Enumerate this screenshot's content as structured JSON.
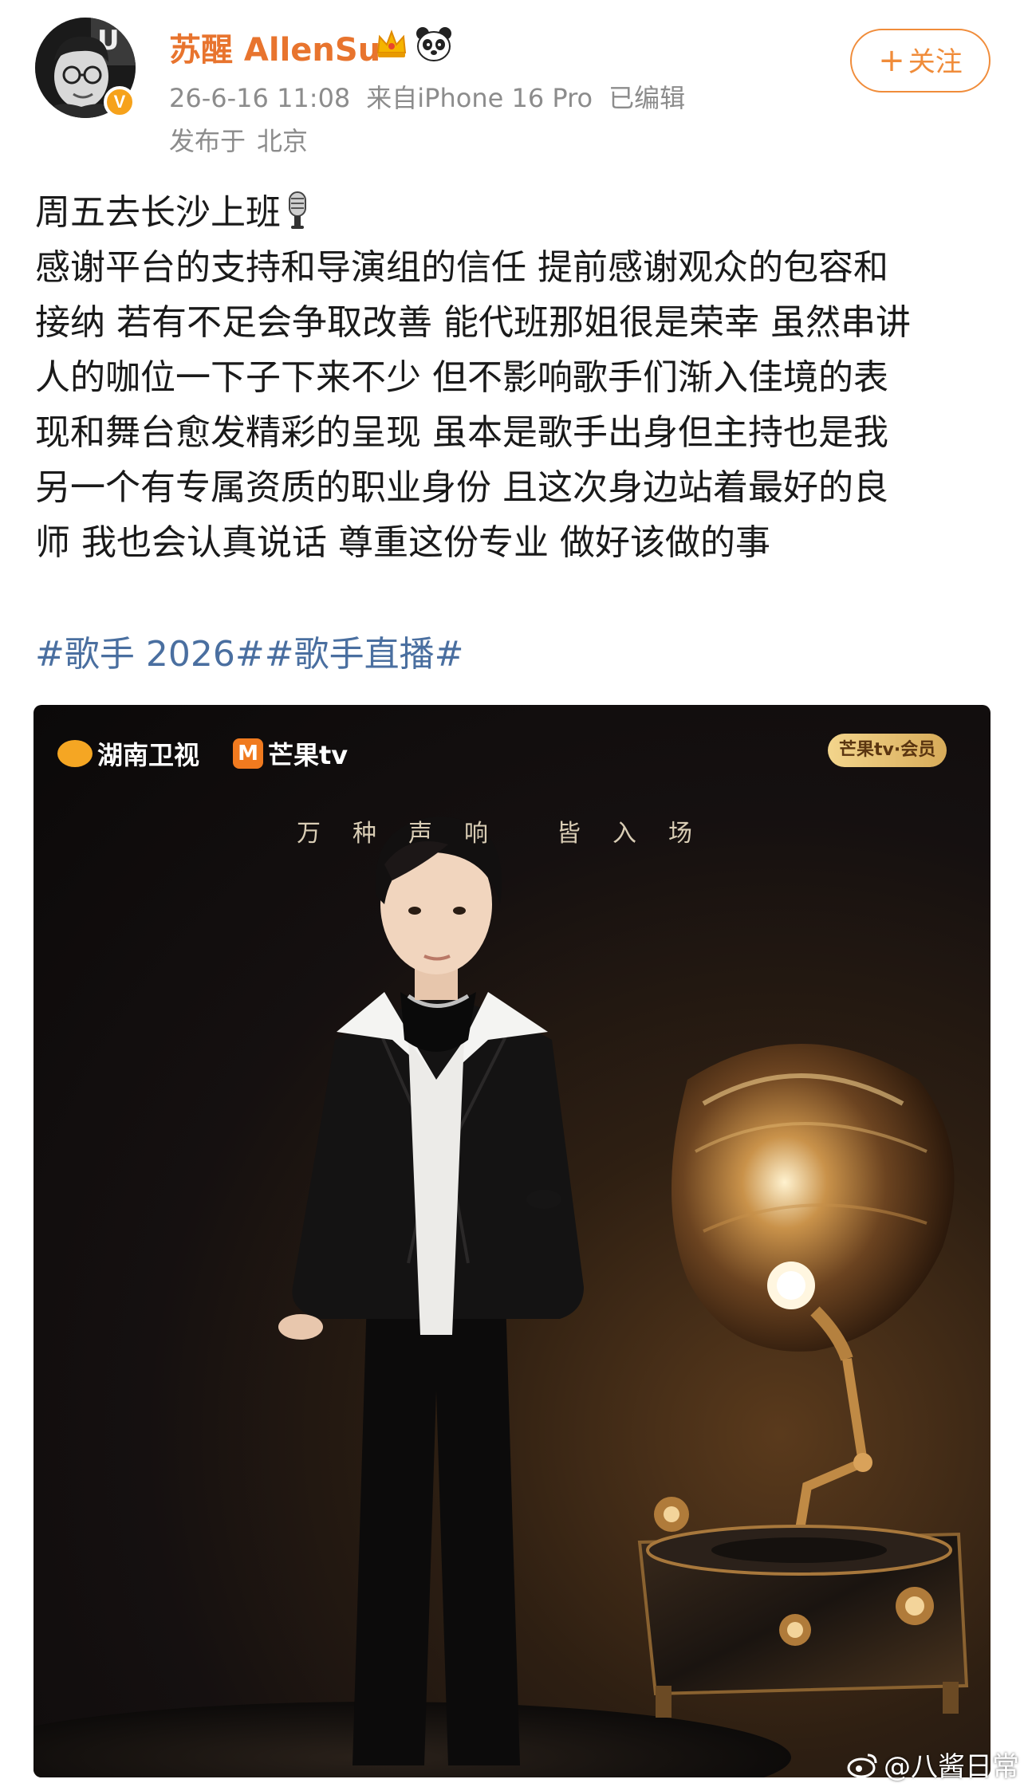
{
  "post": {
    "author": {
      "name": "苏醒 AllenSu",
      "verified_mark": "V",
      "badges": [
        "crown-icon",
        "panda-icon"
      ]
    },
    "meta": {
      "time": "26-6-16 11:08",
      "source": "来自iPhone 16 Pro",
      "edited": "已编辑",
      "location_prefix": "发布于",
      "location": "北京"
    },
    "follow_button": {
      "plus": "+",
      "label": "关注"
    },
    "text_lines": [
      "周五去长沙上班",
      "感谢平台的支持和导演组的信任 提前感谢观众的包容和",
      "接纳 若有不足会争取改善 能代班那姐很是荣幸 虽然串讲",
      "人的咖位一下子下来不少 但不影响歌手们渐入佳境的表",
      "现和舞台愈发精彩的呈现 虽本是歌手出身但主持也是我",
      "另一个有专属资质的职业身份 且这次身边站着最好的良",
      "师 我也会认真说话 尊重这份专业 做好该做的事"
    ],
    "hashtags": [
      "#歌手 2026#",
      "#歌手直播#"
    ]
  },
  "poster": {
    "logo_hunan": "湖南卫视",
    "logo_mango": "芒果tv",
    "mango_mark": "M",
    "member_badge": "芒果tv·会员",
    "slogan_part1": "万种声响",
    "slogan_part2": "皆入场"
  },
  "watermark": {
    "text": "@八酱日常"
  },
  "colors": {
    "name": "#e8742e",
    "meta": "#8c8c8c",
    "hashtag": "#4a6fa0",
    "follow": "#f08c3a",
    "text": "#1a1a1a"
  }
}
